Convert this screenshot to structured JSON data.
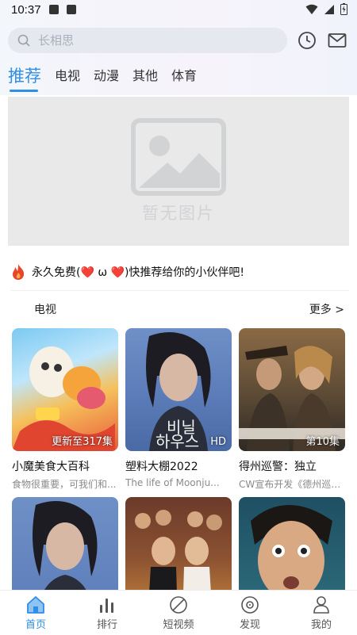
{
  "status_bar": {
    "time": "10:37"
  },
  "search": {
    "placeholder": "长相思"
  },
  "tabs": [
    {
      "label": "推荐",
      "active": true
    },
    {
      "label": "电视",
      "active": false
    },
    {
      "label": "动漫",
      "active": false
    },
    {
      "label": "其他",
      "active": false
    },
    {
      "label": "体育",
      "active": false
    }
  ],
  "banner": {
    "placeholder_text": "暂无图片"
  },
  "notice": {
    "text": "永久免费(❤️ ω ❤️)快推荐给你的小伙伴吧!"
  },
  "section": {
    "title": "电视",
    "more_label": "更多 >"
  },
  "cards": [
    {
      "title": "小魔美食大百科",
      "desc": "食物很重要，可我们和...",
      "badge": "更新至317集"
    },
    {
      "title": "塑料大棚2022",
      "desc": "The life of Moonju...",
      "badge": "HD"
    },
    {
      "title": "得州巡警：独立",
      "desc": "CW宣布开发《德州巡警...",
      "badge": "第10集"
    },
    {
      "title": "",
      "desc": "",
      "badge": ""
    },
    {
      "title": "",
      "desc": "",
      "badge": ""
    },
    {
      "title": "",
      "desc": "",
      "badge": ""
    }
  ],
  "bottom_nav": [
    {
      "label": "首页",
      "icon": "home-icon",
      "active": true
    },
    {
      "label": "排行",
      "icon": "bar-chart-icon",
      "active": false
    },
    {
      "label": "短视频",
      "icon": "compass-icon",
      "active": false
    },
    {
      "label": "发现",
      "icon": "disc-icon",
      "active": false
    },
    {
      "label": "我的",
      "icon": "user-icon",
      "active": false
    }
  ],
  "colors": {
    "accent": "#2f8ee5",
    "notice_flame": "#e8462a"
  }
}
